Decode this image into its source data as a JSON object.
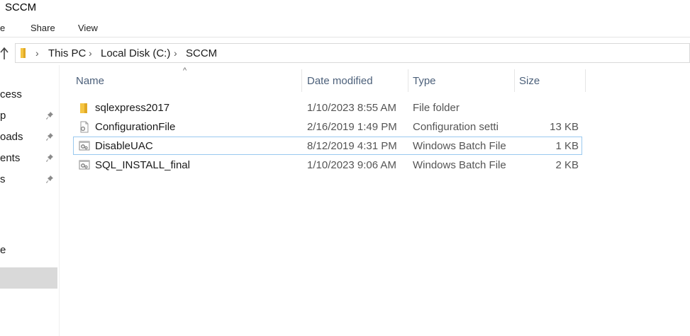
{
  "window": {
    "title": "SCCM"
  },
  "ribbon": {
    "tabs": [
      "e",
      "Share",
      "View"
    ]
  },
  "address": {
    "crumbs": [
      "This PC",
      "Local Disk (C:)",
      "SCCM"
    ]
  },
  "nav": {
    "items": [
      {
        "label": "cess",
        "pinned": false
      },
      {
        "label": "p",
        "pinned": true
      },
      {
        "label": "oads",
        "pinned": true
      },
      {
        "label": "ents",
        "pinned": true
      },
      {
        "label": "s",
        "pinned": true
      },
      {
        "label": "e",
        "pinned": false
      }
    ]
  },
  "columns": {
    "name": "Name",
    "date": "Date modified",
    "type": "Type",
    "size": "Size"
  },
  "files": [
    {
      "name": "sqlexpress2017",
      "date": "1/10/2023 8:55 AM",
      "type": "File folder",
      "size": "",
      "icon": "folder-icon"
    },
    {
      "name": "ConfigurationFile",
      "date": "2/16/2019 1:49 PM",
      "type": "Configuration setti",
      "size": "13 KB",
      "icon": "config-file-icon"
    },
    {
      "name": "DisableUAC",
      "date": "8/12/2019 4:31 PM",
      "type": "Windows Batch File",
      "size": "1 KB",
      "icon": "batch-file-icon"
    },
    {
      "name": "SQL_INSTALL_final",
      "date": "1/10/2023 9:06 AM",
      "type": "Windows Batch File",
      "size": "2 KB",
      "icon": "batch-file-icon"
    }
  ],
  "colors": {
    "folder": "#f5c542",
    "focus_border": "#99c9ef",
    "header_text": "#4c607a",
    "selected_nav": "#d9d9d9"
  }
}
